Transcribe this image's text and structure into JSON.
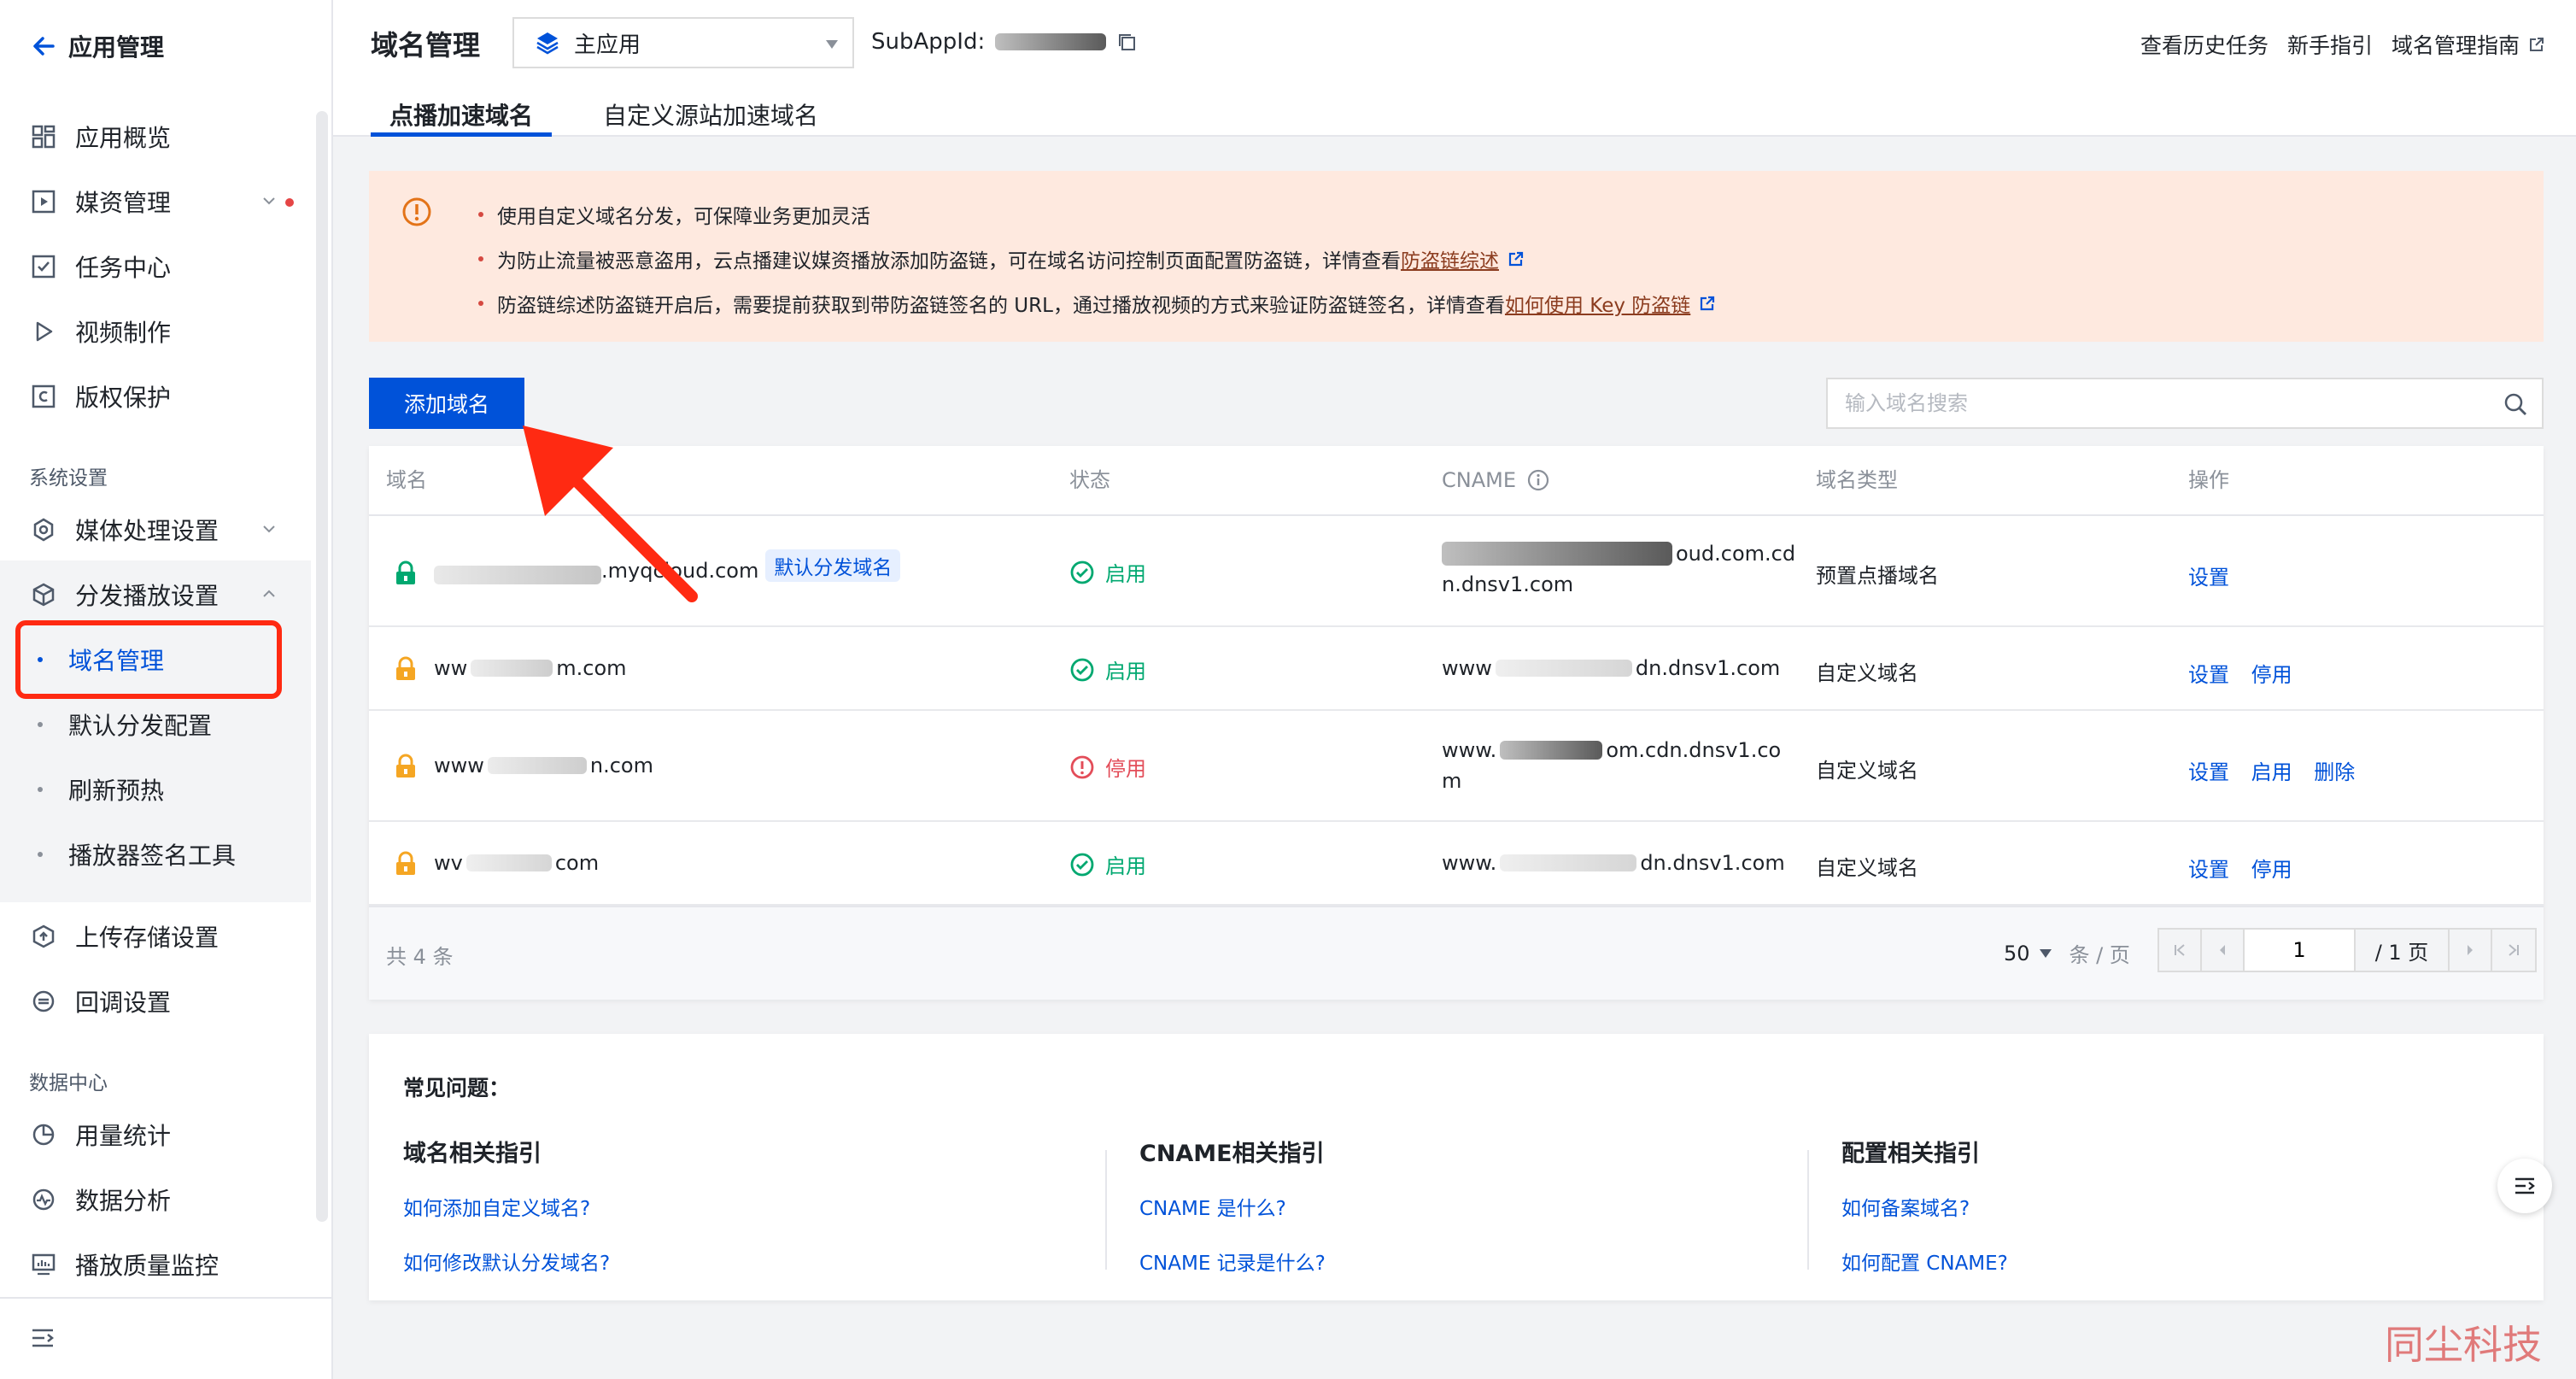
{
  "sidebar": {
    "back_label": "应用管理",
    "items": [
      {
        "label": "应用概览"
      },
      {
        "label": "媒资管理"
      },
      {
        "label": "任务中心"
      },
      {
        "label": "视频制作"
      },
      {
        "label": "版权保护"
      }
    ],
    "section_system": "系统设置",
    "system_items": [
      {
        "label": "媒体处理设置"
      },
      {
        "label": "分发播放设置"
      }
    ],
    "sub_items": [
      {
        "label": "域名管理"
      },
      {
        "label": "默认分发配置"
      },
      {
        "label": "刷新预热"
      },
      {
        "label": "播放器签名工具"
      }
    ],
    "more_items": [
      {
        "label": "上传存储设置"
      },
      {
        "label": "回调设置"
      }
    ],
    "section_data": "数据中心",
    "data_items": [
      {
        "label": "用量统计"
      },
      {
        "label": "数据分析"
      },
      {
        "label": "播放质量监控"
      }
    ]
  },
  "header": {
    "title": "域名管理",
    "app_select": "主应用",
    "subapp_label": "SubAppId:",
    "links": [
      "查看历史任务",
      "新手指引",
      "域名管理指南"
    ],
    "tabs": [
      "点播加速域名",
      "自定义源站加速域名"
    ]
  },
  "notice": {
    "line1": "使用自定义域名分发，可保障业务更加灵活",
    "line2_prefix": "为防止流量被恶意盗用，云点播建议媒资播放添加防盗链，可在域名访问控制页面配置防盗链，详情查看",
    "line2_link": "防盗链综述",
    "line3_prefix": "防盗链综述防盗链开启后，需要提前获取到带防盗链签名的 URL，通过播放视频的方式来验证防盗链签名，详情查看",
    "line3_link": "如何使用 Key 防盗链"
  },
  "toolbar": {
    "add_label": "添加域名",
    "search_placeholder": "输入域名搜索"
  },
  "table": {
    "headers": [
      "域名",
      "状态",
      "CNAME",
      "域名类型",
      "操作"
    ],
    "rows": [
      {
        "domain": ".myqcloud.com",
        "tag": "默认分发域名",
        "status": "启用",
        "cname_a": "oud.com.cd",
        "cname_b": "n.dnsv1.com",
        "type": "预置点播域名",
        "ops": [
          "设置"
        ]
      },
      {
        "domain_a": "ww",
        "domain_b": "m.com",
        "status": "启用",
        "cname_a": "www",
        "cname_b": "dn.dnsv1.com",
        "type": "自定义域名",
        "ops": [
          "设置",
          "停用"
        ]
      },
      {
        "domain_a": "www",
        "domain_b": "n.com",
        "status": "停用",
        "cname_a": "www.",
        "cname_b": "om.cdn.dnsv1.co",
        "cname_c": "m",
        "type": "自定义域名",
        "ops": [
          "设置",
          "启用",
          "删除"
        ]
      },
      {
        "domain_a": "wv",
        "domain_b": "com",
        "status": "启用",
        "cname_a": "www.",
        "cname_b": "dn.dnsv1.com",
        "type": "自定义域名",
        "ops": [
          "设置",
          "停用"
        ]
      }
    ],
    "total": "共 4 条",
    "page_size": "50",
    "page_unit": "条 / 页",
    "page_current": "1",
    "page_total": "/ 1 页"
  },
  "faq": {
    "title": "常见问题：",
    "cols": [
      {
        "heading": "域名相关指引",
        "links": [
          "如何添加自定义域名?",
          "如何修改默认分发域名?"
        ]
      },
      {
        "heading": "CNAME相关指引",
        "links": [
          "CNAME 是什么?",
          "CNAME 记录是什么?"
        ]
      },
      {
        "heading": "配置相关指引",
        "links": [
          "如何备案域名?",
          "如何配置 CNAME?"
        ]
      }
    ]
  },
  "watermark": "同尘科技",
  "colors": {
    "primary": "#0052d9",
    "success": "#00a870",
    "danger": "#e34d59",
    "notice_bg": "#fee9df",
    "annotation": "#ff2a12"
  }
}
